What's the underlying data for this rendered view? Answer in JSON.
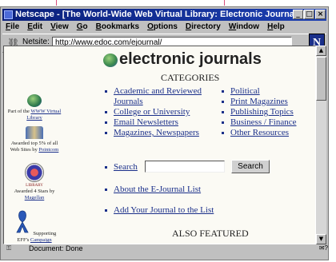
{
  "window": {
    "title": "Netscape - [The World-Wide Web Virtual Library: Electronic Journals]",
    "controls": [
      "_",
      "□",
      "×"
    ]
  },
  "menu": [
    "File",
    "Edit",
    "View",
    "Go",
    "Bookmarks",
    "Options",
    "Directory",
    "Window",
    "Help"
  ],
  "location": {
    "label": "Netsite:",
    "url": "http://www.edoc.com/ejournal/",
    "logo_letter": "N"
  },
  "sidebar": {
    "awards": [
      {
        "icon": "globe-icon",
        "prefix": "Part of the ",
        "link": "WWW Virtual Library",
        "suffix": ""
      },
      {
        "icon": "book-icon",
        "prefix": "Awarded top 5% of all Web Sites by ",
        "link": "Pointcom",
        "suffix": ""
      },
      {
        "icon": "seal-icon",
        "prefix": "Awarded 4 Stars by ",
        "link": "Magellan",
        "suffix": ""
      },
      {
        "icon": "blue-ribbon-icon",
        "prefix": "Supporting EFF's ",
        "link": "Campaign",
        "suffix": ""
      }
    ],
    "library_badge": "LIBRARY"
  },
  "main": {
    "title": "electronic journals",
    "categories_heading": "CATEGORIES",
    "categories_left": [
      "Academic and Reviewed Journals",
      "College or University",
      "Email Newsletters",
      "Magazines, Newspapers"
    ],
    "categories_right": [
      "Political",
      "Print Magazines",
      "Publishing Topics",
      "Business / Finance",
      "Other Resources"
    ],
    "search_label": "Search",
    "search_value": "",
    "search_button": "Search",
    "about_link": "About the E-Journal List",
    "add_link": "Add Your Journal to the List",
    "also_featured": "ALSO FEATURED"
  },
  "status": {
    "text": "Document: Done",
    "right": "✉?"
  },
  "colors": {
    "title_bar": "#0a1f7a",
    "link": "#1a2f8a",
    "page_bg": "#fbfaf4",
    "chrome": "#c0c0c0"
  }
}
